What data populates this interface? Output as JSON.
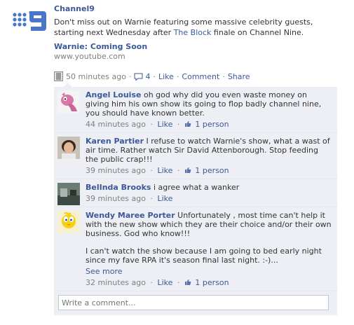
{
  "post": {
    "page_name": "Channel9",
    "text_before": "Don't miss out on Warnie featuring some massive celebrity guests, starting next Wednesday after ",
    "text_link": "The Block",
    "text_after": " finale on Channel Nine.",
    "attachment_title": "Warnie: Coming Soon",
    "attachment_url": "www.youtube.com",
    "time": "50 minutes ago",
    "comment_count": "4",
    "like_label": "Like",
    "comment_label": "Comment",
    "share_label": "Share",
    "separator": "·"
  },
  "comments": [
    {
      "author": "Angel Louise",
      "text": "oh god why did you even waste money on giving him his own show its going to flop badly channel nine, you should have known better.",
      "time": "44 minutes ago",
      "like_label": "Like"
    },
    {
      "author": "Karen Partier",
      "text": "I refuse to watch Warnie's show, what a wast of air time. Rather watch Sir David Attenborough. Stop feeding the public crap!!!",
      "time": "39 minutes ago",
      "like_label": "Like",
      "likes": "1 person"
    },
    {
      "author": "BelInda Brooks",
      "text": "i agree what a wanker",
      "time": "39 minutes ago",
      "like_label": "Like"
    },
    {
      "author": "Wendy Maree Porter",
      "text": "Unfortunately , most time can't help it with the new show which they are their choice and/or their own business. God who know!!!",
      "text2": "I can't watch the show because I am going to bed early night since my fave RPA it's season final last night. :-)...",
      "see_more": "See more",
      "time": "32 minutes ago",
      "like_label": "Like",
      "likes": "1 person"
    }
  ],
  "angel_likes": "1 person",
  "write_comment": {
    "placeholder": "Write a comment..."
  },
  "colors": {
    "link": "#3b5998",
    "meta": "#808080",
    "ufi_bg": "#edeff4",
    "logo": "#4a76c8"
  },
  "icons": [
    "channel9-logo",
    "video-icon",
    "comment-bubble-icon",
    "thumbs-up-icon"
  ]
}
